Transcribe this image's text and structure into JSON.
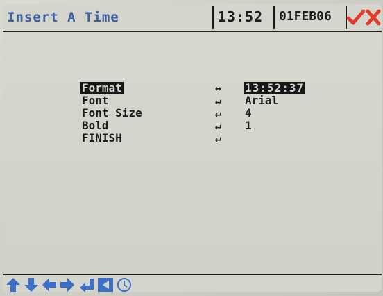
{
  "header": {
    "title": "Insert A Time",
    "clock": "13:52",
    "date": "01FEB06",
    "ok_icon": "check-icon",
    "cancel_icon": "close-icon"
  },
  "menu": {
    "items": [
      {
        "label": "Format",
        "arrow": "↔",
        "value": "13:52:37",
        "selected": true
      },
      {
        "label": "Font",
        "arrow": "↵",
        "value": "Arial"
      },
      {
        "label": "Font Size",
        "arrow": "↵",
        "value": "4"
      },
      {
        "label": "Bold",
        "arrow": "↵",
        "value": "1"
      },
      {
        "label": "FINISH",
        "arrow": "↵",
        "value": ""
      }
    ]
  },
  "toolbar": {
    "buttons": [
      "arrow-up-icon",
      "arrow-down-icon",
      "arrow-left-icon",
      "arrow-right-icon",
      "enter-icon",
      "back-icon",
      "clock-icon"
    ]
  },
  "colors": {
    "accent": "#3d5fa6",
    "confirm": "#e23b2b",
    "background": "#d3d5cc",
    "text": "#1c1c1c"
  }
}
